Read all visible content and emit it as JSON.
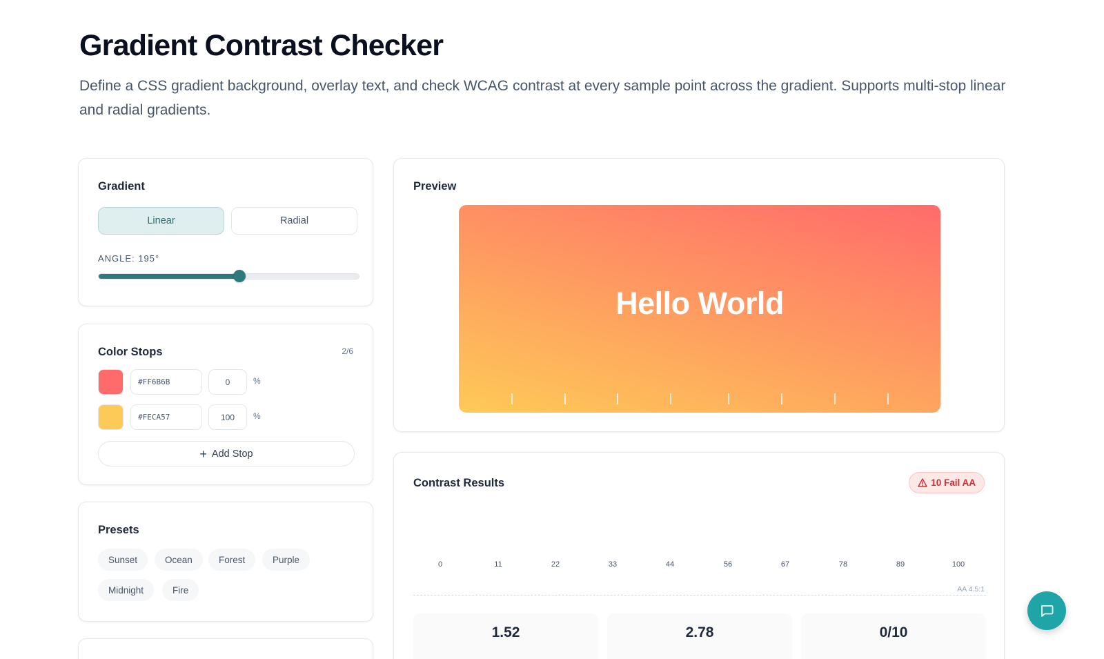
{
  "header": {
    "title": "Gradient Contrast Checker",
    "description": "Define a CSS gradient background, overlay text, and check WCAG contrast at every sample point across the gradient. Supports multi-stop linear and radial gradients."
  },
  "gradient": {
    "title": "Gradient",
    "modes": [
      "Linear",
      "Radial"
    ],
    "active_mode": "Linear",
    "angle_label": "ANGLE: 195°",
    "angle_value": 195,
    "angle_max": 360
  },
  "color_stops": {
    "title": "Color Stops",
    "count": "2/6",
    "stops": [
      {
        "color": "#FF6B6B",
        "hex": "#FF6B6B",
        "position": "0",
        "unit": "%"
      },
      {
        "color": "#FECA57",
        "hex": "#FECA57",
        "position": "100",
        "unit": "%"
      }
    ],
    "add_label": "Add Stop"
  },
  "presets": {
    "title": "Presets",
    "items": [
      "Sunset",
      "Ocean",
      "Forest",
      "Purple",
      "Midnight",
      "Fire"
    ]
  },
  "preview": {
    "title": "Preview",
    "text": "Hello World"
  },
  "contrast": {
    "title": "Contrast Results",
    "badge": "10 Fail AA",
    "sample_points": [
      "0",
      "11",
      "22",
      "33",
      "44",
      "56",
      "67",
      "78",
      "89",
      "100"
    ],
    "aa_label": "AA 4.5:1",
    "stats": [
      "1.52",
      "2.78",
      "0/10"
    ]
  },
  "colors": {
    "accent": "#2c7a7b",
    "fail": "#c53030",
    "fab": "#1fa5a7"
  }
}
